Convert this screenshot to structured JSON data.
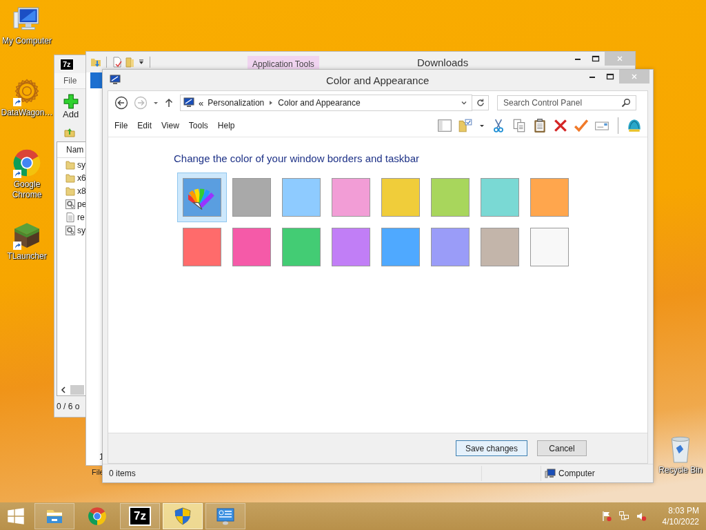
{
  "desktop_icons": [
    {
      "label": "My Computer",
      "kind": "computer",
      "shortcut": false
    },
    {
      "label": "DataWagon…",
      "kind": "mandala",
      "shortcut": true
    },
    {
      "label": "Google Chrome",
      "kind": "browser",
      "shortcut": true
    },
    {
      "label": "TLauncher",
      "kind": "block",
      "shortcut": true
    }
  ],
  "recycle_bin": {
    "label": "Recycle Bin"
  },
  "archive_window": {
    "logo": "7z",
    "menu": "File",
    "toolbar_button": "Add",
    "column": "Nam",
    "files": [
      {
        "name": "sy",
        "kind": "folder"
      },
      {
        "name": "x6",
        "kind": "folder"
      },
      {
        "name": "x8",
        "kind": "folder"
      },
      {
        "name": "pe",
        "kind": "settings"
      },
      {
        "name": "re",
        "kind": "text"
      },
      {
        "name": "sy",
        "kind": "settings"
      }
    ],
    "status": "0 / 6 o"
  },
  "downloads_window": {
    "title": "Downloads",
    "context_tab": "Application Tools",
    "column_1": "1",
    "menu": "File"
  },
  "window": {
    "title": "Color and Appearance",
    "address_prefix": "«",
    "breadcrumb": [
      "Personalization",
      "Color and Appearance"
    ],
    "search": {
      "placeholder": "Search Control Panel"
    },
    "menu": [
      "File",
      "Edit",
      "View",
      "Tools",
      "Help"
    ],
    "heading": "Change the color of your window borders and taskbar",
    "swatches": [
      {
        "kind": "custom",
        "selected": true
      },
      {
        "kind": "color",
        "color": "#a9a9a9",
        "selected": false
      },
      {
        "kind": "color",
        "color": "#8ecbff",
        "selected": false
      },
      {
        "kind": "color",
        "color": "#f29dd6",
        "selected": false
      },
      {
        "kind": "color",
        "color": "#f0cd3a",
        "selected": false
      },
      {
        "kind": "color",
        "color": "#a8d65c",
        "selected": false
      },
      {
        "kind": "color",
        "color": "#7ad9d4",
        "selected": false
      },
      {
        "kind": "color",
        "color": "#ffa64d",
        "selected": false
      },
      {
        "kind": "color",
        "color": "#ff6b6b",
        "selected": false
      },
      {
        "kind": "color",
        "color": "#f55aa8",
        "selected": false
      },
      {
        "kind": "color",
        "color": "#43cc74",
        "selected": false
      },
      {
        "kind": "color",
        "color": "#c17ef6",
        "selected": false
      },
      {
        "kind": "color",
        "color": "#4fa9ff",
        "selected": false
      },
      {
        "kind": "color",
        "color": "#9a9cf8",
        "selected": false
      },
      {
        "kind": "color",
        "color": "#c3b5aa",
        "selected": false
      },
      {
        "kind": "color",
        "color": "#f8f8f8",
        "selected": false
      }
    ],
    "buttons": [
      {
        "label": "Save changes",
        "default": true
      },
      {
        "label": "Cancel",
        "default": false
      }
    ],
    "status_bar": {
      "items": "0 items",
      "location": "Computer"
    }
  },
  "taskbar": {
    "apps": [
      {
        "kind": "explorer",
        "running": true,
        "active": false
      },
      {
        "kind": "browser",
        "running": false,
        "active": false
      },
      {
        "kind": "archiver",
        "label": "7z",
        "running": true,
        "active": false
      },
      {
        "kind": "shield",
        "running": true,
        "active": true
      },
      {
        "kind": "control-panel",
        "running": true,
        "active": false
      }
    ],
    "clock": {
      "time": "8:03 PM",
      "date": "4/10/2022"
    }
  }
}
